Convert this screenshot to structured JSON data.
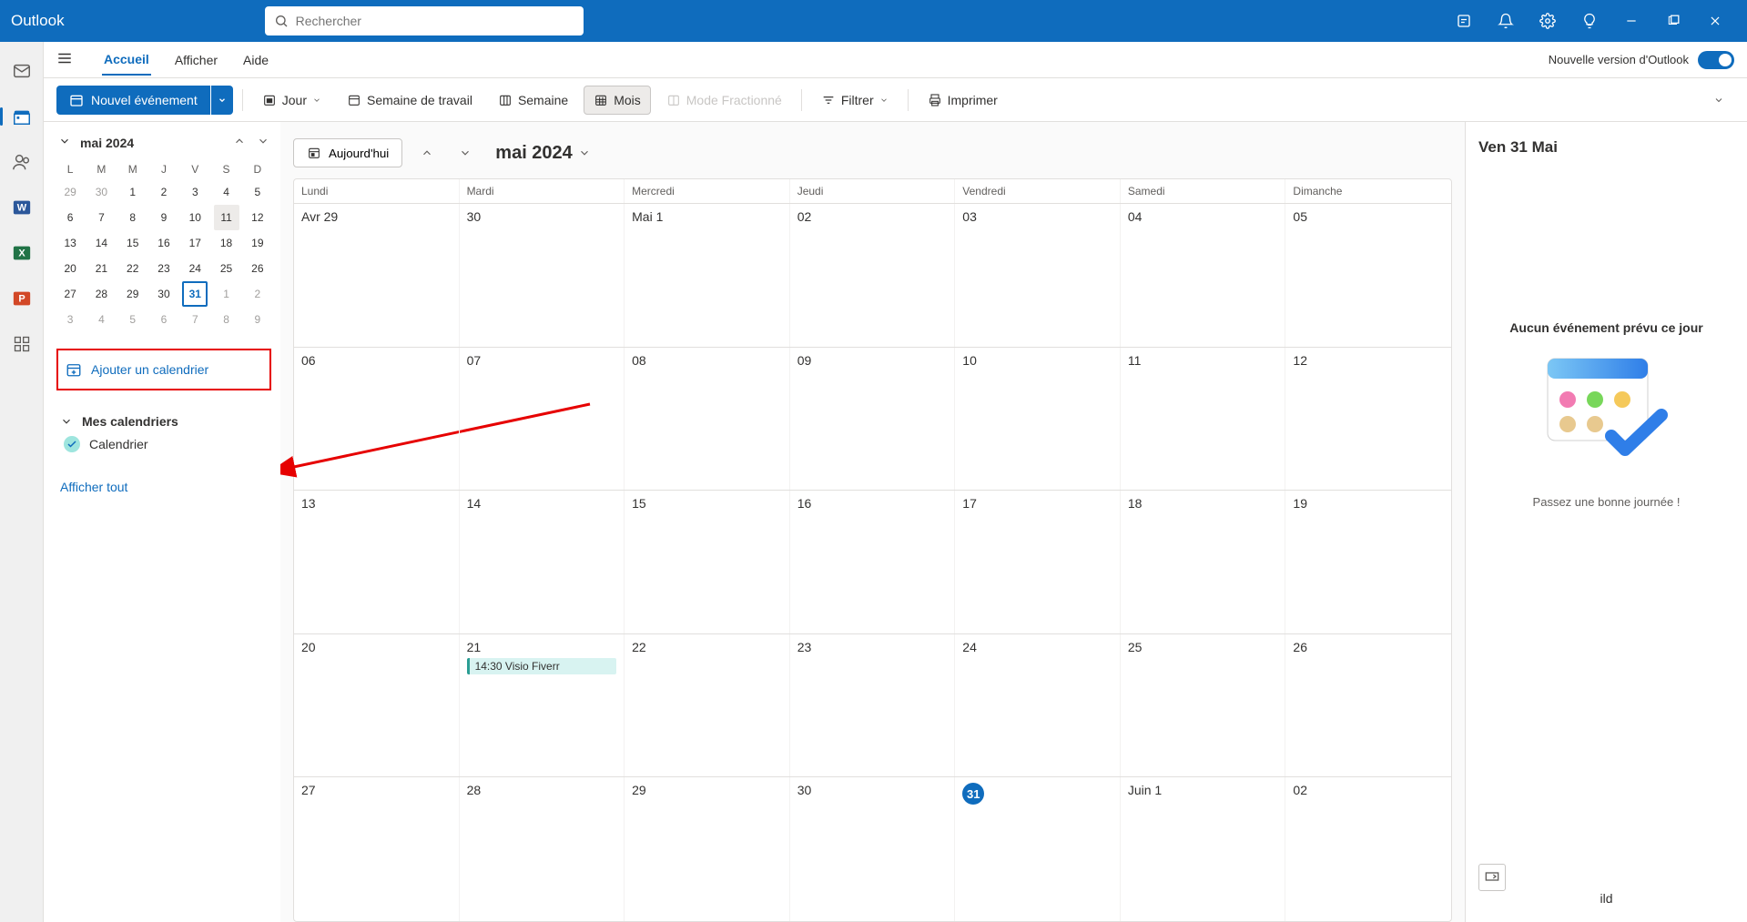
{
  "app": {
    "name": "Outlook",
    "search_placeholder": "Rechercher"
  },
  "ribbon": {
    "tabs": [
      "Accueil",
      "Afficher",
      "Aide"
    ],
    "new_outlook_label": "Nouvelle version d'Outlook"
  },
  "toolbar": {
    "new_event": "Nouvel événement",
    "day": "Jour",
    "workweek": "Semaine de travail",
    "week": "Semaine",
    "month": "Mois",
    "split": "Mode Fractionné",
    "filter": "Filtrer",
    "print": "Imprimer"
  },
  "sidebar": {
    "month_label": "mai 2024",
    "dow": [
      "L",
      "M",
      "M",
      "J",
      "V",
      "S",
      "D"
    ],
    "mini_days": [
      {
        "n": "29",
        "dim": true
      },
      {
        "n": "30",
        "dim": true
      },
      {
        "n": "1"
      },
      {
        "n": "2"
      },
      {
        "n": "3"
      },
      {
        "n": "4"
      },
      {
        "n": "5"
      },
      {
        "n": "6"
      },
      {
        "n": "7"
      },
      {
        "n": "8"
      },
      {
        "n": "9"
      },
      {
        "n": "10"
      },
      {
        "n": "11",
        "hl": true
      },
      {
        "n": "12"
      },
      {
        "n": "13"
      },
      {
        "n": "14"
      },
      {
        "n": "15"
      },
      {
        "n": "16"
      },
      {
        "n": "17"
      },
      {
        "n": "18"
      },
      {
        "n": "19"
      },
      {
        "n": "20"
      },
      {
        "n": "21"
      },
      {
        "n": "22"
      },
      {
        "n": "23"
      },
      {
        "n": "24"
      },
      {
        "n": "25"
      },
      {
        "n": "26"
      },
      {
        "n": "27"
      },
      {
        "n": "28"
      },
      {
        "n": "29"
      },
      {
        "n": "30"
      },
      {
        "n": "31",
        "selected": true
      },
      {
        "n": "1",
        "dim": true
      },
      {
        "n": "2",
        "dim": true
      },
      {
        "n": "3",
        "dim": true
      },
      {
        "n": "4",
        "dim": true
      },
      {
        "n": "5",
        "dim": true
      },
      {
        "n": "6",
        "dim": true
      },
      {
        "n": "7",
        "dim": true
      },
      {
        "n": "8",
        "dim": true
      },
      {
        "n": "9",
        "dim": true
      }
    ],
    "add_calendar": "Ajouter un calendrier",
    "my_calendars": "Mes calendriers",
    "calendar_item": "Calendrier",
    "show_all": "Afficher tout"
  },
  "calendar": {
    "today_btn": "Aujourd'hui",
    "title": "mai 2024",
    "weekdays": [
      "Lundi",
      "Mardi",
      "Mercredi",
      "Jeudi",
      "Vendredi",
      "Samedi",
      "Dimanche"
    ],
    "weeks": [
      [
        {
          "label": "Avr 29"
        },
        {
          "label": "30"
        },
        {
          "label": "Mai 1"
        },
        {
          "label": "02"
        },
        {
          "label": "03"
        },
        {
          "label": "04"
        },
        {
          "label": "05"
        }
      ],
      [
        {
          "label": "06"
        },
        {
          "label": "07"
        },
        {
          "label": "08"
        },
        {
          "label": "09"
        },
        {
          "label": "10"
        },
        {
          "label": "11"
        },
        {
          "label": "12"
        }
      ],
      [
        {
          "label": "13"
        },
        {
          "label": "14"
        },
        {
          "label": "15"
        },
        {
          "label": "16"
        },
        {
          "label": "17"
        },
        {
          "label": "18"
        },
        {
          "label": "19"
        }
      ],
      [
        {
          "label": "20"
        },
        {
          "label": "21",
          "event": {
            "time": "14:30",
            "title": "Visio Fiverr"
          }
        },
        {
          "label": "22"
        },
        {
          "label": "23"
        },
        {
          "label": "24"
        },
        {
          "label": "25"
        },
        {
          "label": "26"
        }
      ],
      [
        {
          "label": "27"
        },
        {
          "label": "28"
        },
        {
          "label": "29"
        },
        {
          "label": "30"
        },
        {
          "label": "31",
          "today": true
        },
        {
          "label": "Juin 1"
        },
        {
          "label": "02"
        }
      ]
    ]
  },
  "right": {
    "date_title": "Ven 31 Mai",
    "empty": "Aucun événement prévu ce jour",
    "nice_day": "Passez une bonne journée !"
  }
}
